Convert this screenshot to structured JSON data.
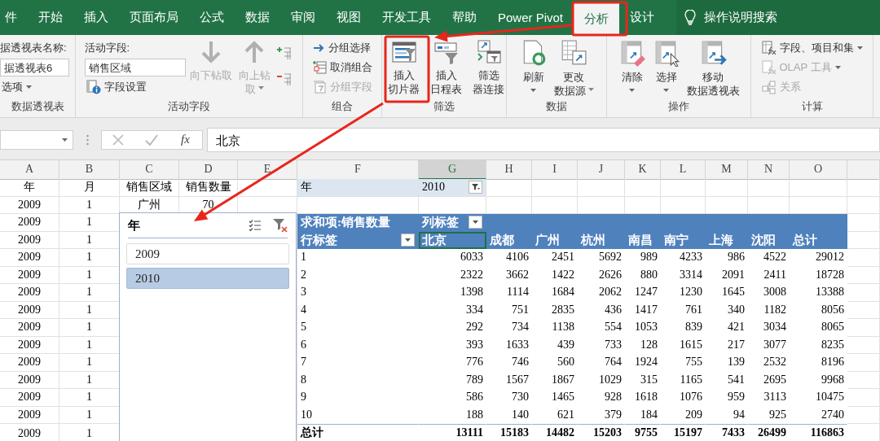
{
  "menu_tabs": [
    {
      "label": "件",
      "selected": false
    },
    {
      "label": "开始",
      "selected": false
    },
    {
      "label": "插入",
      "selected": false
    },
    {
      "label": "页面布局",
      "selected": false
    },
    {
      "label": "公式",
      "selected": false
    },
    {
      "label": "数据",
      "selected": false
    },
    {
      "label": "审阅",
      "selected": false
    },
    {
      "label": "视图",
      "selected": false
    },
    {
      "label": "开发工具",
      "selected": false
    },
    {
      "label": "帮助",
      "selected": false
    },
    {
      "label": "Power Pivot",
      "selected": false
    },
    {
      "label": "分析",
      "selected": true
    },
    {
      "label": "设计",
      "selected": false
    }
  ],
  "tell_me": "操作说明搜索",
  "ribbon_groups": [
    {
      "label": "数据透视表",
      "columns": [
        [
          {
            "kind": "label",
            "text": "据透视表名称:",
            "disabled": false
          },
          {
            "kind": "field",
            "text": "据透视表6",
            "disabled": false
          },
          {
            "kind": "small",
            "text": "选项",
            "dropdown": true,
            "disabled": false
          }
        ]
      ]
    },
    {
      "label": "活动字段",
      "columns": [
        [
          {
            "kind": "label",
            "text": "活动字段:",
            "disabled": false
          },
          {
            "kind": "field",
            "text": "销售区域",
            "disabled": false
          },
          {
            "kind": "small",
            "text": "字段设置",
            "disabled": false
          }
        ],
        [
          {
            "kind": "large",
            "lines": [
              "向下钻取"
            ],
            "disabled": true
          }
        ],
        [
          {
            "kind": "large",
            "lines": [
              "向上钻",
              "取"
            ],
            "dropdown": true,
            "disabled": true
          }
        ],
        [
          {
            "kind": "icon",
            "disabled": false
          },
          {
            "kind": "icon",
            "disabled": false
          }
        ]
      ]
    },
    {
      "label": "组合",
      "columns": [
        [
          {
            "kind": "small",
            "text": "分组选择",
            "disabled": false
          },
          {
            "kind": "small",
            "text": "取消组合",
            "disabled": false
          },
          {
            "kind": "small",
            "text": "分组字段",
            "disabled": true
          }
        ]
      ]
    },
    {
      "label": "筛选",
      "columns": [
        [
          {
            "kind": "large",
            "lines": [
              "插入",
              "切片器"
            ],
            "disabled": false
          }
        ],
        [
          {
            "kind": "large",
            "lines": [
              "插入",
              "日程表"
            ],
            "disabled": false
          }
        ],
        [
          {
            "kind": "large",
            "lines": [
              "筛选",
              "器连接"
            ],
            "disabled": false
          }
        ]
      ]
    },
    {
      "label": "数据",
      "columns": [
        [
          {
            "kind": "large",
            "lines": [
              "刷新"
            ],
            "dropdown": true,
            "disabled": false
          }
        ],
        [
          {
            "kind": "large",
            "lines": [
              "更改",
              "数据源"
            ],
            "dropdown": true,
            "disabled": false
          }
        ]
      ]
    },
    {
      "label": "操作",
      "columns": [
        [
          {
            "kind": "large",
            "lines": [
              "清除"
            ],
            "dropdown": true,
            "disabled": false
          }
        ],
        [
          {
            "kind": "large",
            "lines": [
              "选择"
            ],
            "dropdown": true,
            "disabled": false
          }
        ],
        [
          {
            "kind": "large",
            "lines": [
              "移动",
              "数据透视表"
            ],
            "disabled": false
          }
        ]
      ]
    },
    {
      "label": "计算",
      "columns": [
        [
          {
            "kind": "small",
            "text": "字段、项目和集",
            "dropdown": true,
            "disabled": false
          },
          {
            "kind": "small",
            "text": "OLAP 工具",
            "dropdown": true,
            "disabled": true
          },
          {
            "kind": "small",
            "text": "关系",
            "disabled": true
          }
        ]
      ]
    }
  ],
  "formula_bar": {
    "function_button": "fx",
    "value": "北京"
  },
  "column_headers": [
    {
      "label": "A",
      "selected": false
    },
    {
      "label": "B",
      "selected": false
    },
    {
      "label": "C",
      "selected": false
    },
    {
      "label": "D",
      "selected": false
    },
    {
      "label": "E",
      "selected": false
    },
    {
      "label": "F",
      "selected": false
    },
    {
      "label": "G",
      "selected": true
    },
    {
      "label": "H",
      "selected": false
    },
    {
      "label": "I",
      "selected": false
    },
    {
      "label": "J",
      "selected": false
    },
    {
      "label": "K",
      "selected": false
    },
    {
      "label": "L",
      "selected": false
    },
    {
      "label": "M",
      "selected": false
    },
    {
      "label": "N",
      "selected": false
    },
    {
      "label": "O",
      "selected": false
    }
  ],
  "source_rows": [
    [
      "年",
      "月",
      "销售区域",
      "销售数量"
    ],
    [
      "2009",
      "1",
      "广州",
      "70"
    ],
    [
      "2009",
      "1"
    ],
    [
      "2009",
      "1"
    ],
    [
      "2009",
      "1"
    ],
    [
      "2009",
      "1"
    ],
    [
      "2009",
      "1"
    ],
    [
      "2009",
      "1"
    ],
    [
      "2009",
      "1"
    ],
    [
      "2009",
      "1"
    ],
    [
      "2009",
      "1"
    ],
    [
      "2009",
      "1"
    ],
    [
      "2009",
      "1"
    ],
    [
      "2009",
      "1"
    ],
    [
      "2009",
      "1"
    ]
  ],
  "pivot": {
    "filter_label": "年",
    "filter_value": "2010",
    "value_caption": "求和项:销售数量",
    "column_labels": "列标签",
    "row_labels": "行标签",
    "columns": [
      {
        "label": "北京",
        "selected": true
      },
      {
        "label": "成都",
        "selected": false
      },
      {
        "label": "广州",
        "selected": false
      },
      {
        "label": "杭州",
        "selected": false
      },
      {
        "label": "南昌",
        "selected": false
      },
      {
        "label": "南宁",
        "selected": false
      },
      {
        "label": "上海",
        "selected": false
      },
      {
        "label": "沈阳",
        "selected": false
      },
      {
        "label": "总计",
        "selected": false
      }
    ],
    "rows": [
      {
        "label": "1",
        "values": [
          "6033",
          "4106",
          "2451",
          "5692",
          "989",
          "4233",
          "986",
          "4522",
          "29012"
        ]
      },
      {
        "label": "2",
        "values": [
          "2322",
          "3662",
          "1422",
          "2626",
          "880",
          "3314",
          "2091",
          "2411",
          "18728"
        ]
      },
      {
        "label": "3",
        "values": [
          "1398",
          "1114",
          "1684",
          "2062",
          "1247",
          "1230",
          "1645",
          "3008",
          "13388"
        ]
      },
      {
        "label": "4",
        "values": [
          "334",
          "751",
          "2835",
          "436",
          "1417",
          "761",
          "340",
          "1182",
          "8056"
        ]
      },
      {
        "label": "5",
        "values": [
          "292",
          "734",
          "1138",
          "554",
          "1053",
          "839",
          "421",
          "3034",
          "8065"
        ]
      },
      {
        "label": "6",
        "values": [
          "393",
          "1633",
          "439",
          "733",
          "128",
          "1615",
          "217",
          "3077",
          "8235"
        ]
      },
      {
        "label": "7",
        "values": [
          "776",
          "746",
          "560",
          "764",
          "1924",
          "755",
          "139",
          "2532",
          "8196"
        ]
      },
      {
        "label": "8",
        "values": [
          "789",
          "1567",
          "1867",
          "1029",
          "315",
          "1165",
          "541",
          "2695",
          "9968"
        ]
      },
      {
        "label": "9",
        "values": [
          "586",
          "730",
          "1465",
          "928",
          "1618",
          "1076",
          "959",
          "3113",
          "10475"
        ]
      },
      {
        "label": "10",
        "values": [
          "188",
          "140",
          "621",
          "379",
          "184",
          "209",
          "94",
          "925",
          "2740"
        ]
      }
    ],
    "total": {
      "label": "总计",
      "values": [
        "13111",
        "15183",
        "14482",
        "15203",
        "9755",
        "15197",
        "7433",
        "26499",
        "116863"
      ]
    }
  },
  "slicer": {
    "title": "年",
    "items": [
      {
        "label": "2009",
        "selected": false
      },
      {
        "label": "2010",
        "selected": true
      }
    ]
  }
}
